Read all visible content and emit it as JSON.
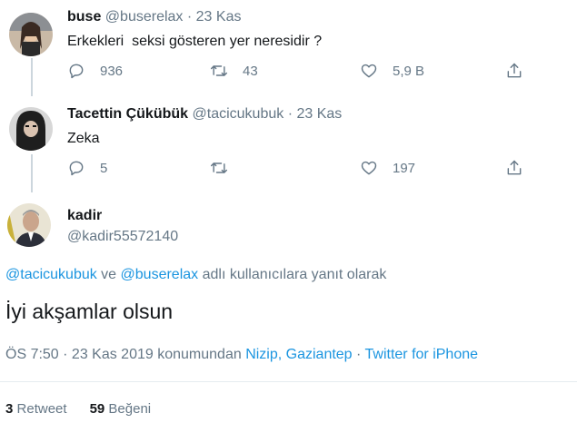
{
  "tweets": [
    {
      "display_name": "buse",
      "handle": "@buserelax",
      "separator": "·",
      "date": "23 Kas",
      "text": "Erkekleri  seksi gösteren yer neresidir ?",
      "replies": "936",
      "retweets": "43",
      "likes": "5,9 B"
    },
    {
      "display_name": "Tacettin Çükübük",
      "handle": "@tacicukubuk",
      "separator": "·",
      "date": "23 Kas",
      "text": "Zeka",
      "replies": "5",
      "retweets": "",
      "likes": "197"
    }
  ],
  "main_tweet": {
    "display_name": "kadir",
    "handle": "@kadir55572140",
    "reply_to": {
      "user1": "@tacicukubuk",
      "conj": " ve ",
      "user2": "@buserelax",
      "suffix": " adlı kullanıcılara yanıt olarak"
    },
    "text": "İyi akşamlar olsun",
    "time": "ÖS 7:50 · 23 Kas 2019 konumundan ",
    "location": "Nizip, Gaziantep",
    "dot": " · ",
    "source": "Twitter for iPhone",
    "retweet_count": "3",
    "retweet_label": "Retweet",
    "like_count": "59",
    "like_label": "Beğeni"
  },
  "colors": {
    "text": "#14171a",
    "secondary": "#657786",
    "link": "#1b95e0",
    "line": "#ccd6dd"
  },
  "icons": [
    "reply-icon",
    "retweet-icon",
    "like-icon",
    "share-icon"
  ]
}
